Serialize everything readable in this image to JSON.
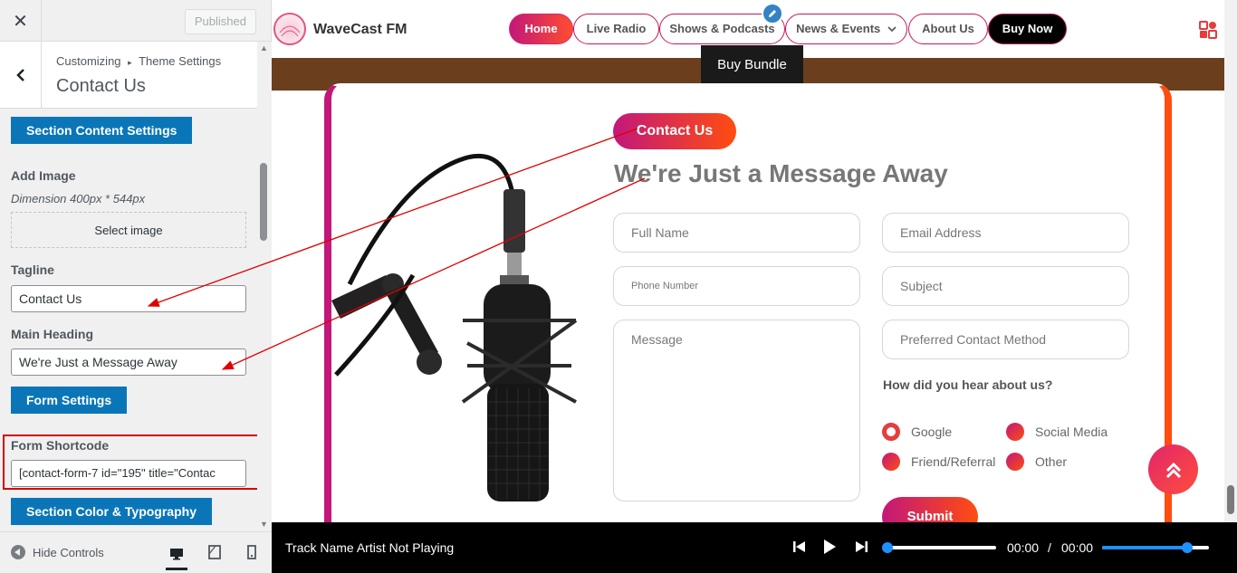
{
  "customizer": {
    "close_label": "✕",
    "published_label": "Published",
    "breadcrumb_root": "Customizing",
    "breadcrumb_sep": "▸",
    "breadcrumb_parent": "Theme Settings",
    "panel_title": "Contact Us",
    "section_content_btn": "Section Content Settings",
    "add_image_label": "Add Image",
    "image_dimension": "Dimension 400px * 544px",
    "select_image_btn": "Select image",
    "tagline_label": "Tagline",
    "tagline_value": "Contact Us",
    "main_heading_label": "Main Heading",
    "main_heading_value": "We're Just a Message Away",
    "form_settings_btn": "Form Settings",
    "form_shortcode_label": "Form Shortcode",
    "form_shortcode_value": "[contact-form-7 id=\"195\" title=\"Contac",
    "section_color_btn": "Section Color & Typography",
    "hide_controls_label": "Hide Controls"
  },
  "site": {
    "title": "WaveCast FM",
    "nav": [
      "Home",
      "Live Radio",
      "Shows & Podcasts",
      "News & Events",
      "About Us",
      "Buy Now"
    ],
    "nav_dropdown_icon": "chevron-down-icon",
    "buy_bundle": "Buy Bundle"
  },
  "contact": {
    "tagline": "Contact Us",
    "heading": "We're Just a Message Away",
    "fields": {
      "full_name": "Full Name",
      "email": "Email Address",
      "phone": "Phone Number",
      "subject": "Subject",
      "message": "Message",
      "preferred": "Preferred Contact Method"
    },
    "hear_label": "How did you hear about us?",
    "options": [
      "Google",
      "Social Media",
      "Friend/Referral",
      "Other"
    ],
    "submit": "Submit"
  },
  "player": {
    "track": "Track Name Artist Not Playing",
    "current_time": "00:00",
    "separator": "/",
    "duration": "00:00",
    "progress": 0,
    "volume": 0.8
  },
  "colors": {
    "accent_start": "#c2187a",
    "accent_end": "#ff4d10",
    "wp_blue": "#0a76b8",
    "highlight_red": "#d40000"
  }
}
